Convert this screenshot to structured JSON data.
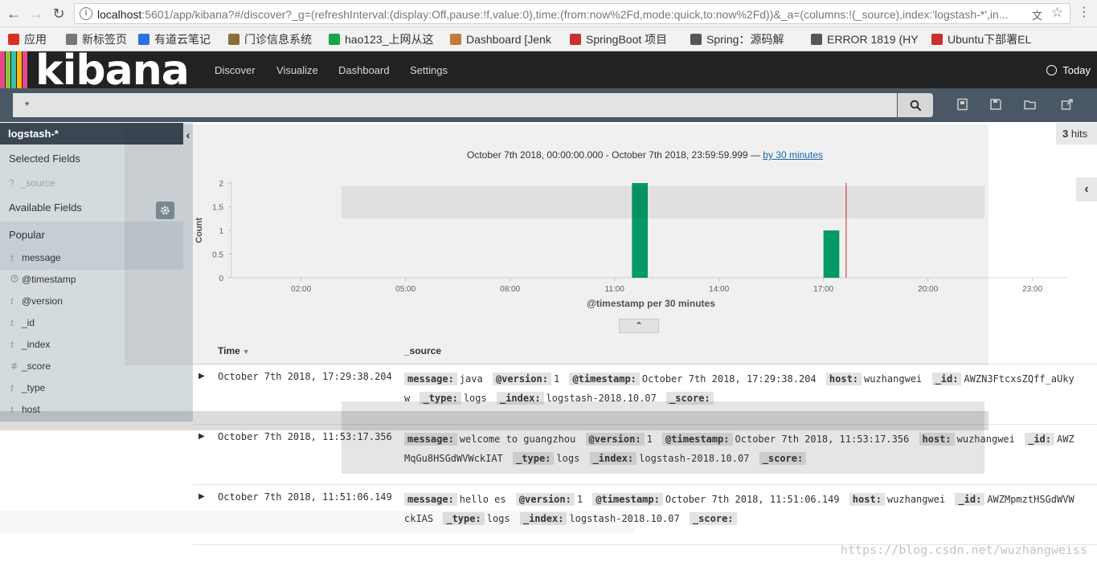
{
  "browser": {
    "url_host": "localhost",
    "url_rest": ":5601/app/kibana?#/discover?_g=(refreshInterval:(display:Off,pause:!f,value:0),time:(from:now%2Fd,mode:quick,to:now%2Fd))&_a=(columns:!(_source),index:'logstash-*',in...",
    "bookmarks": [
      {
        "label": "应用",
        "icon": "apps-grid-icon",
        "color": "#d93025"
      },
      {
        "label": "新标签页",
        "icon": "page-icon",
        "color": "#777777"
      },
      {
        "label": "有道云笔记",
        "icon": "note-icon",
        "color": "#2f6fe0"
      },
      {
        "label": "门诊信息系统",
        "icon": "image-icon",
        "color": "#8a6d3b"
      },
      {
        "label": "hao123_上网从这",
        "icon": "hao-icon",
        "color": "#1aa34a"
      },
      {
        "label": "Dashboard [Jenk",
        "icon": "jenkins-icon",
        "color": "#c47a3a"
      },
      {
        "label": "SpringBoot 项目",
        "icon": "csdn-icon",
        "color": "#c9302c"
      },
      {
        "label": "Spring：源码解",
        "icon": "feather-icon",
        "color": "#555555"
      },
      {
        "label": "ERROR 1819 (HY",
        "icon": "feather-icon",
        "color": "#555555"
      },
      {
        "label": "Ubuntu下部署EL",
        "icon": "csdn-icon",
        "color": "#c9302c"
      }
    ]
  },
  "nav": {
    "logo_text": "kibana",
    "links": [
      "Discover",
      "Visualize",
      "Dashboard",
      "Settings"
    ],
    "time_picker": "Today"
  },
  "search": {
    "query": "*"
  },
  "sidebar": {
    "index_pattern": "logstash-*",
    "selected_fields_heading": "Selected Fields",
    "selected_fields": [
      {
        "type": "?",
        "name": "_source"
      }
    ],
    "available_fields_heading": "Available Fields",
    "popular_heading": "Popular",
    "fields": [
      {
        "type": "t",
        "name": "message"
      },
      {
        "type": "clock",
        "name": "@timestamp"
      },
      {
        "type": "t",
        "name": "@version"
      },
      {
        "type": "t",
        "name": "_id"
      },
      {
        "type": "t",
        "name": "_index"
      },
      {
        "type": "#",
        "name": "_score"
      },
      {
        "type": "t",
        "name": "_type"
      },
      {
        "type": "t",
        "name": "host"
      }
    ]
  },
  "main": {
    "hits_count": "3",
    "hits_label": "hits",
    "time_range_text": "October 7th 2018, 00:00:00.000 - October 7th 2018, 23:59:59.999 —",
    "interval_link": "by 30 minutes"
  },
  "chart_data": {
    "type": "bar",
    "ylabel": "Count",
    "xlabel": "@timestamp per 30 minutes",
    "x_ticks": [
      "02:00",
      "05:00",
      "08:00",
      "11:00",
      "14:00",
      "17:00",
      "20:00",
      "23:00"
    ],
    "y_ticks": [
      "0",
      "0.5",
      "1",
      "1.5",
      "2"
    ],
    "ylim": [
      0,
      2
    ],
    "x_range_hours": [
      0,
      24
    ],
    "bars": [
      {
        "start_hour": 11.5,
        "value": 2
      },
      {
        "start_hour": 17.0,
        "value": 1
      }
    ],
    "now_marker_hour": 17.65,
    "bar_color": "#00a26b",
    "marker_color": "#d9534f"
  },
  "table": {
    "col_time": "Time",
    "col_source": "_source",
    "rows": [
      {
        "time": "October 7th 2018, 17:29:38.204",
        "fields": [
          {
            "k": "message:",
            "v": "java"
          },
          {
            "k": "@version:",
            "v": "1"
          },
          {
            "k": "@timestamp:",
            "v": "October 7th 2018, 17:29:38.204"
          },
          {
            "k": "host:",
            "v": "wuzhangwei"
          },
          {
            "k": "_id:",
            "v": "AWZN3FtcxsZQff_aUkyw"
          },
          {
            "k": "_type:",
            "v": "logs"
          },
          {
            "k": "_index:",
            "v": "logstash-2018.10.07"
          },
          {
            "k": "_score:",
            "v": ""
          }
        ]
      },
      {
        "time": "October 7th 2018, 11:53:17.356",
        "fields": [
          {
            "k": "message:",
            "v": "welcome to guangzhou"
          },
          {
            "k": "@version:",
            "v": "1"
          },
          {
            "k": "@timestamp:",
            "v": "October 7th 2018, 11:53:17.356"
          },
          {
            "k": "host:",
            "v": "wuzhangwei"
          },
          {
            "k": "_id:",
            "v": "AWZMqGu8HSGdWVWckIAT"
          },
          {
            "k": "_type:",
            "v": "logs"
          },
          {
            "k": "_index:",
            "v": "logstash-2018.10.07"
          },
          {
            "k": "_score:",
            "v": ""
          }
        ]
      },
      {
        "time": "October 7th 2018, 11:51:06.149",
        "fields": [
          {
            "k": "message:",
            "v": "hello es"
          },
          {
            "k": "@version:",
            "v": "1"
          },
          {
            "k": "@timestamp:",
            "v": "October 7th 2018, 11:51:06.149"
          },
          {
            "k": "host:",
            "v": "wuzhangwei"
          },
          {
            "k": "_id:",
            "v": "AWZMpmztHSGdWVWckIAS"
          },
          {
            "k": "_type:",
            "v": "logs"
          },
          {
            "k": "_index:",
            "v": "logstash-2018.10.07"
          },
          {
            "k": "_score:",
            "v": ""
          }
        ]
      }
    ]
  },
  "watermark": "https://blog.csdn.net/wuzhangweiss"
}
